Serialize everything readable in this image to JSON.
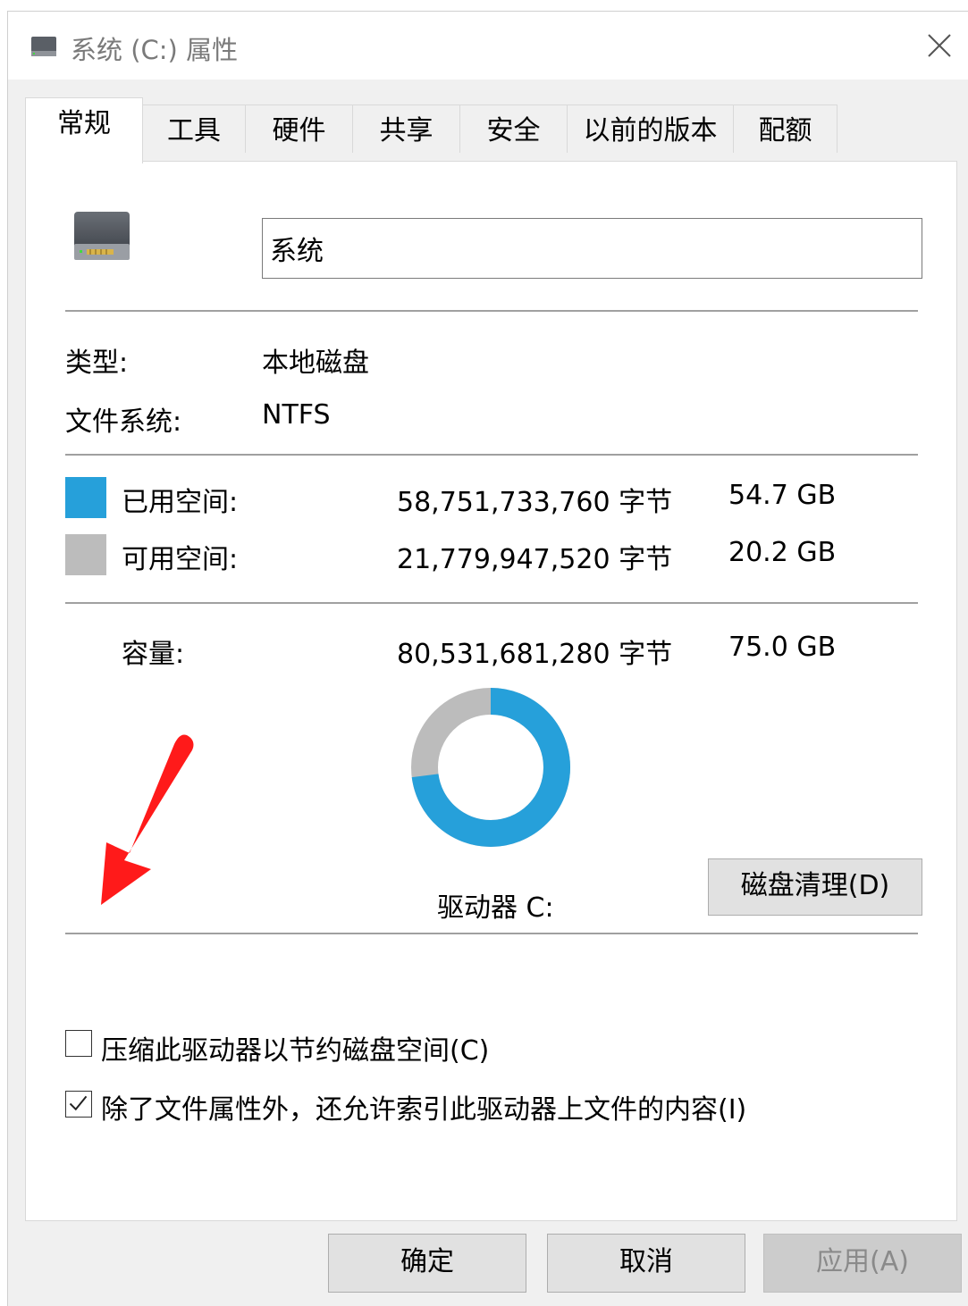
{
  "window": {
    "title": "系统 (C:) 属性",
    "close_symbol": "✕"
  },
  "tabs": [
    {
      "label": "常规",
      "active": true
    },
    {
      "label": "工具",
      "active": false
    },
    {
      "label": "硬件",
      "active": false
    },
    {
      "label": "共享",
      "active": false
    },
    {
      "label": "安全",
      "active": false
    },
    {
      "label": "以前的版本",
      "active": false
    },
    {
      "label": "配额",
      "active": false
    }
  ],
  "general": {
    "volume_name": "系统",
    "type_label": "类型:",
    "type_value": "本地磁盘",
    "fs_label": "文件系统:",
    "fs_value": "NTFS",
    "used": {
      "label": "已用空间:",
      "bytes": "58,751,733,760 字节",
      "size": "54.7 GB",
      "color": "#26a0da"
    },
    "free": {
      "label": "可用空间:",
      "bytes": "21,779,947,520 字节",
      "size": "20.2 GB",
      "color": "#bcbcbc"
    },
    "capacity": {
      "label": "容量:",
      "bytes": "80,531,681,280 字节",
      "size": "75.0 GB"
    },
    "used_fraction": 0.7296,
    "drive_label": "驱动器 C:",
    "cleanup_button": "磁盘清理(D)",
    "compress_option": {
      "label": "压缩此驱动器以节约磁盘空间(C)",
      "checked": false
    },
    "index_option": {
      "label": "除了文件属性外，还允许索引此驱动器上文件的内容(I)",
      "checked": true
    }
  },
  "buttons": {
    "ok": "确定",
    "cancel": "取消",
    "apply": "应用(A)"
  },
  "annotation": {
    "arrow_color": "#ff1a1a"
  }
}
